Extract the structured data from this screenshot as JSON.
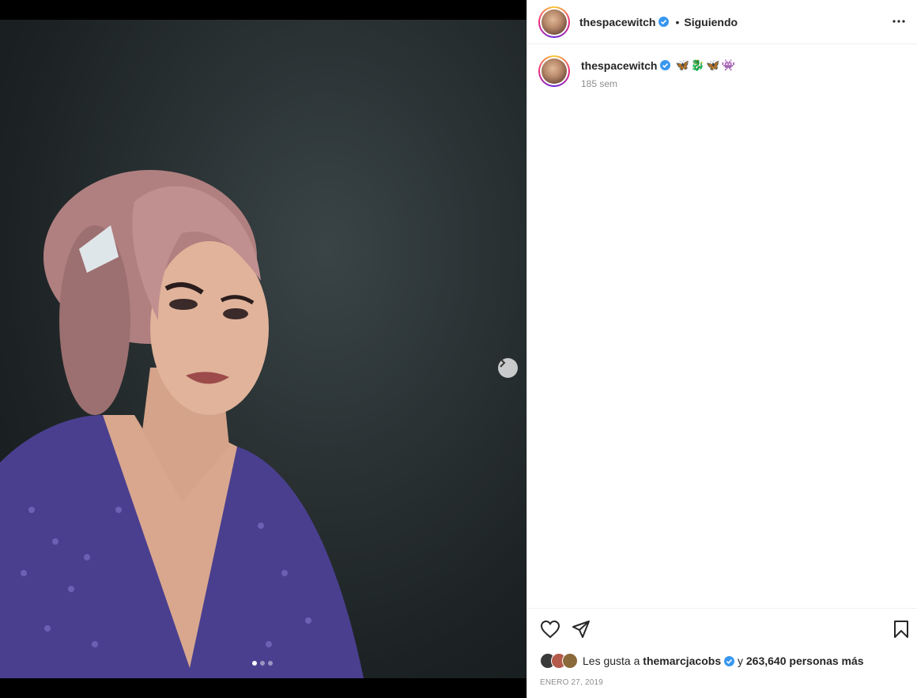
{
  "post": {
    "username": "thespacewitch",
    "follow_status": "Siguiendo",
    "separator": "•",
    "caption_emojis": "🦋🐉🦋👾",
    "time_ago": "185 sem",
    "likes": {
      "prefix": "Les gusta a ",
      "user": "themarcjacobs",
      "conjunction": " y ",
      "count_text": "263,640 personas más"
    },
    "date": "ENERO 27, 2019"
  },
  "carousel": {
    "slides": 3,
    "active": 0
  },
  "icons": {
    "verified": "verified-badge-icon",
    "more": "more-options-icon",
    "like": "heart-icon",
    "share": "paper-plane-icon",
    "save": "bookmark-icon",
    "next": "chevron-right-icon"
  },
  "colors": {
    "verified": "#3897f0",
    "text": "#262626",
    "muted": "#8e8e8e"
  }
}
